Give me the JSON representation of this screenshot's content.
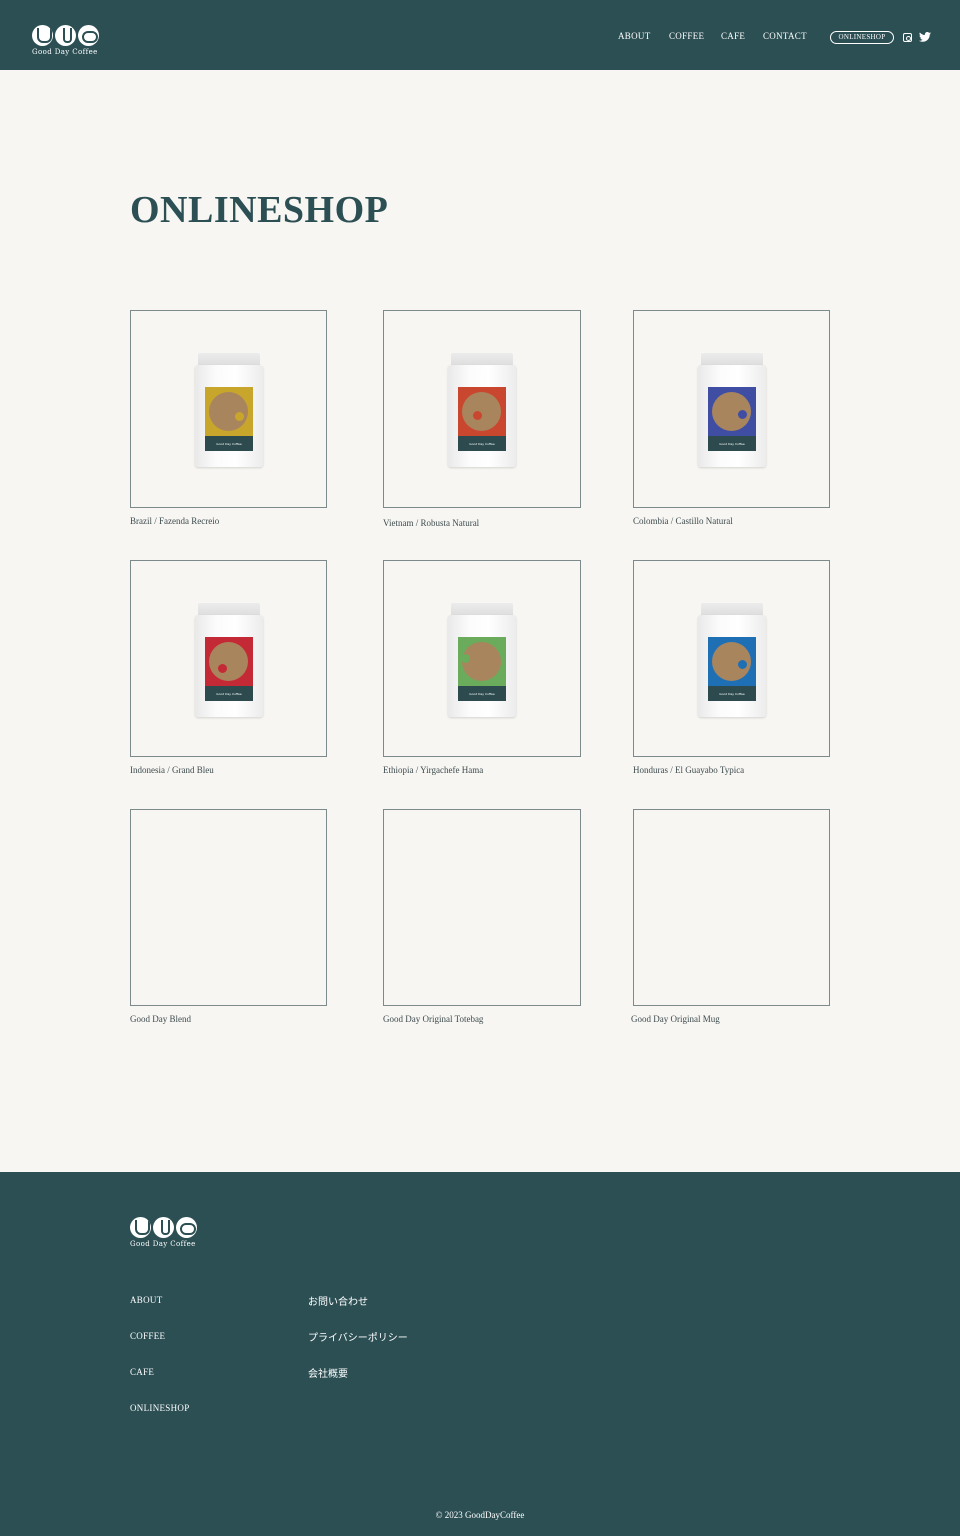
{
  "colors": {
    "primary": "#2c4f54",
    "background": "#f7f6f3",
    "bag_label_band": "#2d4b4e",
    "coffee_disc": "#a9855e"
  },
  "header": {
    "logo": {
      "text": "Good Day Coffee",
      "icon": "good-day-coffee-logo"
    },
    "nav": [
      "ABOUT",
      "COFFEE",
      "CAFE",
      "CONTACT"
    ],
    "shop_button": "ONLINESHOP",
    "social": [
      "instagram-icon",
      "twitter-icon"
    ]
  },
  "main": {
    "title": "ONLINESHOP",
    "products": [
      {
        "name": "Brazil /    Fazenda Recreio",
        "bag_color": "#c8a62c",
        "dot_color": "#c8a62c",
        "has_image": true
      },
      {
        "name": "Vietnam / Robusta Natural",
        "bag_color": "#c9472f",
        "dot_color": "#c9472f",
        "has_image": true
      },
      {
        "name": "Colombia / Castillo Natural",
        "bag_color": "#3f4ea3",
        "dot_color": "#3f4ea3",
        "has_image": true
      },
      {
        "name": "Indonesia / Grand Bleu",
        "bag_color": "#c42a35",
        "dot_color": "#c42a35",
        "has_image": true
      },
      {
        "name": "Ethiopia / Yirgachefe Hama",
        "bag_color": "#6bab5c",
        "dot_color": "#6bab5c",
        "has_image": true
      },
      {
        "name": "Honduras / El Guayabo Typica",
        "bag_color": "#1f6fb5",
        "dot_color": "#1f6fb5",
        "has_image": true
      },
      {
        "name": "Good Day Blend",
        "has_image": false
      },
      {
        "name": "Good Day Original Totebag",
        "has_image": false
      },
      {
        "name": "Good Day Original Mug",
        "has_image": false
      }
    ]
  },
  "footer": {
    "logo_text": "Good Day Coffee",
    "links": [
      "ABOUT",
      "COFFEE",
      "CAFE",
      "ONLINESHOP"
    ],
    "jp_links": [
      "お問い合わせ",
      "プライバシーポリシー",
      "会社概要"
    ],
    "copyright": "© 2023 GoodDayCoffee"
  }
}
